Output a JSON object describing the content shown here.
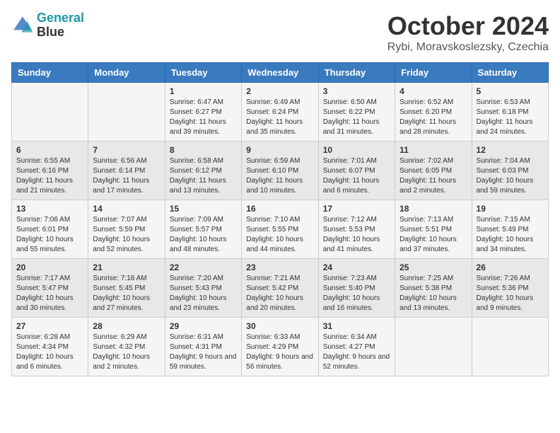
{
  "header": {
    "logo_line1": "General",
    "logo_line2": "Blue",
    "month": "October 2024",
    "location": "Rybi, Moravskoslezsky, Czechia"
  },
  "weekdays": [
    "Sunday",
    "Monday",
    "Tuesday",
    "Wednesday",
    "Thursday",
    "Friday",
    "Saturday"
  ],
  "weeks": [
    [
      {
        "day": "",
        "sunrise": "",
        "sunset": "",
        "daylight": ""
      },
      {
        "day": "",
        "sunrise": "",
        "sunset": "",
        "daylight": ""
      },
      {
        "day": "1",
        "sunrise": "Sunrise: 6:47 AM",
        "sunset": "Sunset: 6:27 PM",
        "daylight": "Daylight: 11 hours and 39 minutes."
      },
      {
        "day": "2",
        "sunrise": "Sunrise: 6:49 AM",
        "sunset": "Sunset: 6:24 PM",
        "daylight": "Daylight: 11 hours and 35 minutes."
      },
      {
        "day": "3",
        "sunrise": "Sunrise: 6:50 AM",
        "sunset": "Sunset: 6:22 PM",
        "daylight": "Daylight: 11 hours and 31 minutes."
      },
      {
        "day": "4",
        "sunrise": "Sunrise: 6:52 AM",
        "sunset": "Sunset: 6:20 PM",
        "daylight": "Daylight: 11 hours and 28 minutes."
      },
      {
        "day": "5",
        "sunrise": "Sunrise: 6:53 AM",
        "sunset": "Sunset: 6:18 PM",
        "daylight": "Daylight: 11 hours and 24 minutes."
      }
    ],
    [
      {
        "day": "6",
        "sunrise": "Sunrise: 6:55 AM",
        "sunset": "Sunset: 6:16 PM",
        "daylight": "Daylight: 11 hours and 21 minutes."
      },
      {
        "day": "7",
        "sunrise": "Sunrise: 6:56 AM",
        "sunset": "Sunset: 6:14 PM",
        "daylight": "Daylight: 11 hours and 17 minutes."
      },
      {
        "day": "8",
        "sunrise": "Sunrise: 6:58 AM",
        "sunset": "Sunset: 6:12 PM",
        "daylight": "Daylight: 11 hours and 13 minutes."
      },
      {
        "day": "9",
        "sunrise": "Sunrise: 6:59 AM",
        "sunset": "Sunset: 6:10 PM",
        "daylight": "Daylight: 11 hours and 10 minutes."
      },
      {
        "day": "10",
        "sunrise": "Sunrise: 7:01 AM",
        "sunset": "Sunset: 6:07 PM",
        "daylight": "Daylight: 11 hours and 6 minutes."
      },
      {
        "day": "11",
        "sunrise": "Sunrise: 7:02 AM",
        "sunset": "Sunset: 6:05 PM",
        "daylight": "Daylight: 11 hours and 2 minutes."
      },
      {
        "day": "12",
        "sunrise": "Sunrise: 7:04 AM",
        "sunset": "Sunset: 6:03 PM",
        "daylight": "Daylight: 10 hours and 59 minutes."
      }
    ],
    [
      {
        "day": "13",
        "sunrise": "Sunrise: 7:06 AM",
        "sunset": "Sunset: 6:01 PM",
        "daylight": "Daylight: 10 hours and 55 minutes."
      },
      {
        "day": "14",
        "sunrise": "Sunrise: 7:07 AM",
        "sunset": "Sunset: 5:59 PM",
        "daylight": "Daylight: 10 hours and 52 minutes."
      },
      {
        "day": "15",
        "sunrise": "Sunrise: 7:09 AM",
        "sunset": "Sunset: 5:57 PM",
        "daylight": "Daylight: 10 hours and 48 minutes."
      },
      {
        "day": "16",
        "sunrise": "Sunrise: 7:10 AM",
        "sunset": "Sunset: 5:55 PM",
        "daylight": "Daylight: 10 hours and 44 minutes."
      },
      {
        "day": "17",
        "sunrise": "Sunrise: 7:12 AM",
        "sunset": "Sunset: 5:53 PM",
        "daylight": "Daylight: 10 hours and 41 minutes."
      },
      {
        "day": "18",
        "sunrise": "Sunrise: 7:13 AM",
        "sunset": "Sunset: 5:51 PM",
        "daylight": "Daylight: 10 hours and 37 minutes."
      },
      {
        "day": "19",
        "sunrise": "Sunrise: 7:15 AM",
        "sunset": "Sunset: 5:49 PM",
        "daylight": "Daylight: 10 hours and 34 minutes."
      }
    ],
    [
      {
        "day": "20",
        "sunrise": "Sunrise: 7:17 AM",
        "sunset": "Sunset: 5:47 PM",
        "daylight": "Daylight: 10 hours and 30 minutes."
      },
      {
        "day": "21",
        "sunrise": "Sunrise: 7:18 AM",
        "sunset": "Sunset: 5:45 PM",
        "daylight": "Daylight: 10 hours and 27 minutes."
      },
      {
        "day": "22",
        "sunrise": "Sunrise: 7:20 AM",
        "sunset": "Sunset: 5:43 PM",
        "daylight": "Daylight: 10 hours and 23 minutes."
      },
      {
        "day": "23",
        "sunrise": "Sunrise: 7:21 AM",
        "sunset": "Sunset: 5:42 PM",
        "daylight": "Daylight: 10 hours and 20 minutes."
      },
      {
        "day": "24",
        "sunrise": "Sunrise: 7:23 AM",
        "sunset": "Sunset: 5:40 PM",
        "daylight": "Daylight: 10 hours and 16 minutes."
      },
      {
        "day": "25",
        "sunrise": "Sunrise: 7:25 AM",
        "sunset": "Sunset: 5:38 PM",
        "daylight": "Daylight: 10 hours and 13 minutes."
      },
      {
        "day": "26",
        "sunrise": "Sunrise: 7:26 AM",
        "sunset": "Sunset: 5:36 PM",
        "daylight": "Daylight: 10 hours and 9 minutes."
      }
    ],
    [
      {
        "day": "27",
        "sunrise": "Sunrise: 6:28 AM",
        "sunset": "Sunset: 4:34 PM",
        "daylight": "Daylight: 10 hours and 6 minutes."
      },
      {
        "day": "28",
        "sunrise": "Sunrise: 6:29 AM",
        "sunset": "Sunset: 4:32 PM",
        "daylight": "Daylight: 10 hours and 2 minutes."
      },
      {
        "day": "29",
        "sunrise": "Sunrise: 6:31 AM",
        "sunset": "Sunset: 4:31 PM",
        "daylight": "Daylight: 9 hours and 59 minutes."
      },
      {
        "day": "30",
        "sunrise": "Sunrise: 6:33 AM",
        "sunset": "Sunset: 4:29 PM",
        "daylight": "Daylight: 9 hours and 56 minutes."
      },
      {
        "day": "31",
        "sunrise": "Sunrise: 6:34 AM",
        "sunset": "Sunset: 4:27 PM",
        "daylight": "Daylight: 9 hours and 52 minutes."
      },
      {
        "day": "",
        "sunrise": "",
        "sunset": "",
        "daylight": ""
      },
      {
        "day": "",
        "sunrise": "",
        "sunset": "",
        "daylight": ""
      }
    ]
  ]
}
